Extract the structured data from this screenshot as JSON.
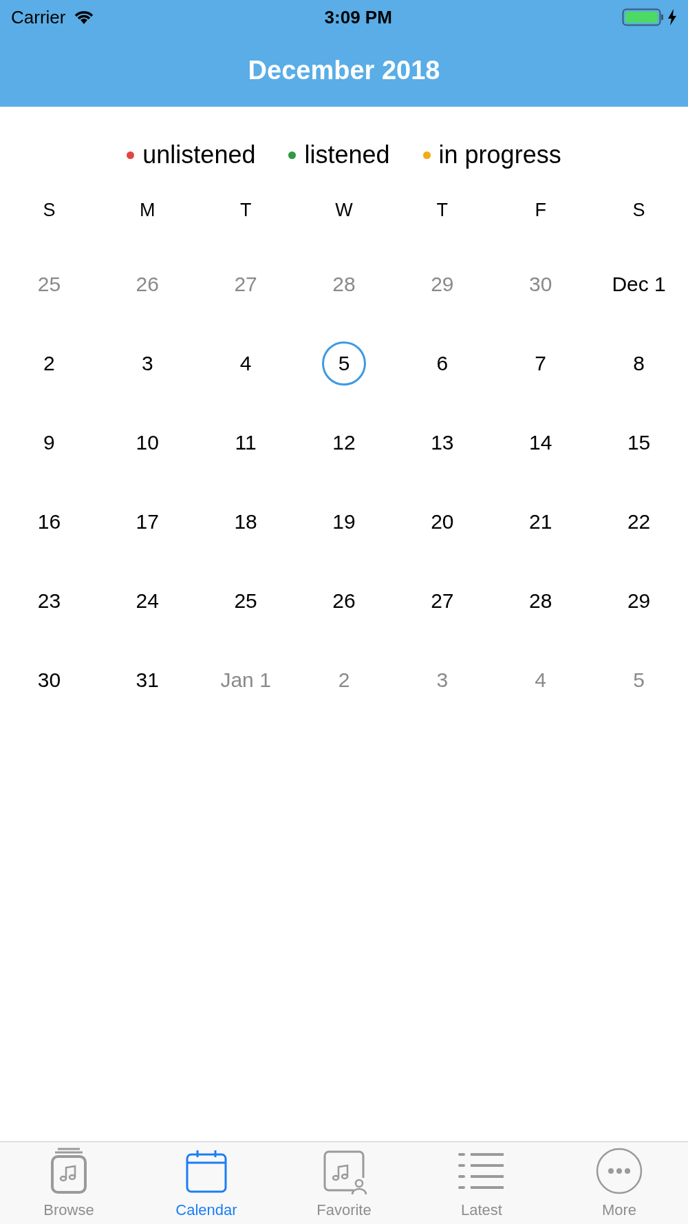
{
  "status_bar": {
    "carrier": "Carrier",
    "time": "3:09 PM",
    "charging": true
  },
  "header": {
    "title": "December 2018"
  },
  "legend": [
    {
      "label": "unlistened",
      "color": "#e04545"
    },
    {
      "label": "listened",
      "color": "#2e9a44"
    },
    {
      "label": "in progress",
      "color": "#f7a90f"
    }
  ],
  "weekdays": [
    "S",
    "M",
    "T",
    "W",
    "T",
    "F",
    "S"
  ],
  "weeks": [
    [
      {
        "day": "25",
        "in_month": false,
        "selected": false
      },
      {
        "day": "26",
        "in_month": false,
        "selected": false
      },
      {
        "day": "27",
        "in_month": false,
        "selected": false
      },
      {
        "day": "28",
        "in_month": false,
        "selected": false
      },
      {
        "day": "29",
        "in_month": false,
        "selected": false
      },
      {
        "day": "30",
        "in_month": false,
        "selected": false
      },
      {
        "day": "Dec 1",
        "in_month": true,
        "selected": false
      }
    ],
    [
      {
        "day": "2",
        "in_month": true,
        "selected": false
      },
      {
        "day": "3",
        "in_month": true,
        "selected": false
      },
      {
        "day": "4",
        "in_month": true,
        "selected": false
      },
      {
        "day": "5",
        "in_month": true,
        "selected": true
      },
      {
        "day": "6",
        "in_month": true,
        "selected": false
      },
      {
        "day": "7",
        "in_month": true,
        "selected": false
      },
      {
        "day": "8",
        "in_month": true,
        "selected": false
      }
    ],
    [
      {
        "day": "9",
        "in_month": true,
        "selected": false
      },
      {
        "day": "10",
        "in_month": true,
        "selected": false
      },
      {
        "day": "11",
        "in_month": true,
        "selected": false
      },
      {
        "day": "12",
        "in_month": true,
        "selected": false
      },
      {
        "day": "13",
        "in_month": true,
        "selected": false
      },
      {
        "day": "14",
        "in_month": true,
        "selected": false
      },
      {
        "day": "15",
        "in_month": true,
        "selected": false
      }
    ],
    [
      {
        "day": "16",
        "in_month": true,
        "selected": false
      },
      {
        "day": "17",
        "in_month": true,
        "selected": false
      },
      {
        "day": "18",
        "in_month": true,
        "selected": false
      },
      {
        "day": "19",
        "in_month": true,
        "selected": false
      },
      {
        "day": "20",
        "in_month": true,
        "selected": false
      },
      {
        "day": "21",
        "in_month": true,
        "selected": false
      },
      {
        "day": "22",
        "in_month": true,
        "selected": false
      }
    ],
    [
      {
        "day": "23",
        "in_month": true,
        "selected": false
      },
      {
        "day": "24",
        "in_month": true,
        "selected": false
      },
      {
        "day": "25",
        "in_month": true,
        "selected": false
      },
      {
        "day": "26",
        "in_month": true,
        "selected": false
      },
      {
        "day": "27",
        "in_month": true,
        "selected": false
      },
      {
        "day": "28",
        "in_month": true,
        "selected": false
      },
      {
        "day": "29",
        "in_month": true,
        "selected": false
      }
    ],
    [
      {
        "day": "30",
        "in_month": true,
        "selected": false
      },
      {
        "day": "31",
        "in_month": true,
        "selected": false
      },
      {
        "day": "Jan 1",
        "in_month": false,
        "selected": false
      },
      {
        "day": "2",
        "in_month": false,
        "selected": false
      },
      {
        "day": "3",
        "in_month": false,
        "selected": false
      },
      {
        "day": "4",
        "in_month": false,
        "selected": false
      },
      {
        "day": "5",
        "in_month": false,
        "selected": false
      }
    ]
  ],
  "tab_bar": [
    {
      "label": "Browse",
      "kind": "browse",
      "selected": false
    },
    {
      "label": "Calendar",
      "kind": "calendar",
      "selected": true
    },
    {
      "label": "Favorite",
      "kind": "favorite",
      "selected": false
    },
    {
      "label": "Latest",
      "kind": "latest",
      "selected": false
    },
    {
      "label": "More",
      "kind": "more",
      "selected": false
    }
  ]
}
